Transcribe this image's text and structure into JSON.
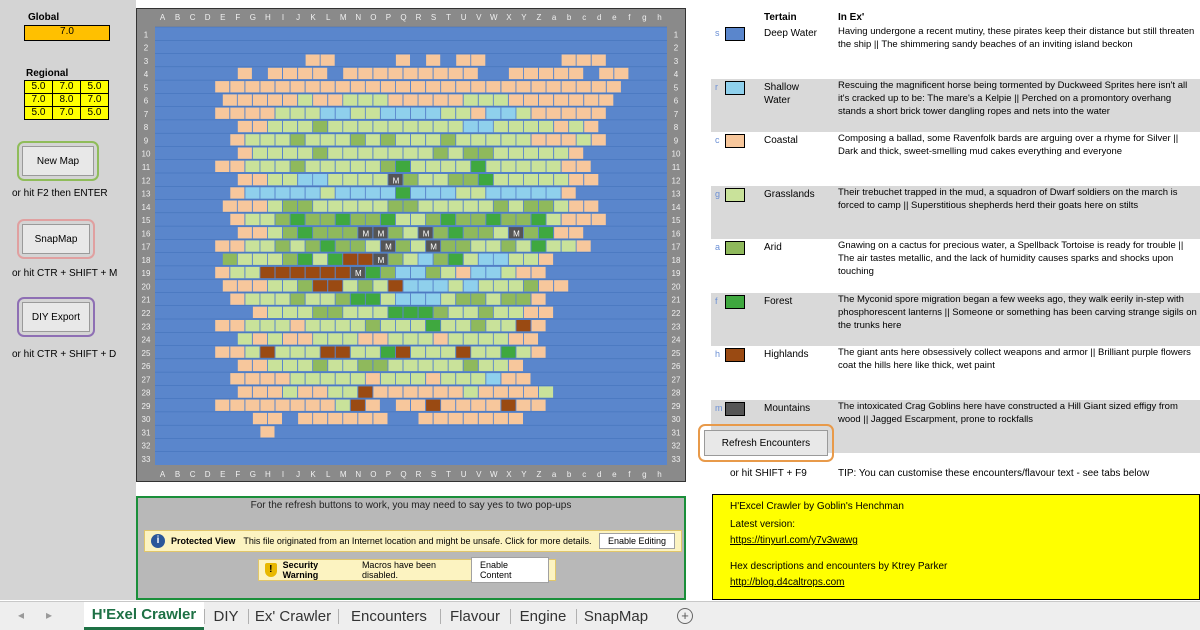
{
  "left": {
    "global_label": "Global",
    "global_value": "7.0",
    "regional_label": "Regional",
    "regional_values": [
      [
        "5.0",
        "7.0",
        "5.0"
      ],
      [
        "7.0",
        "8.0",
        "7.0"
      ],
      [
        "5.0",
        "7.0",
        "5.0"
      ]
    ],
    "new_map_label": "New Map",
    "new_map_hint": "or hit F2 then ENTER",
    "snapmap_label": "SnapMap",
    "snapmap_hint": "or hit CTR + SHIFT + M",
    "diy_label": "DIY Export",
    "diy_hint": "or hit CTR + SHIFT + D",
    "new_map_ring": "#8fbc5a",
    "snapmap_ring": "#e0a0a0",
    "diy_ring": "#8e6fb4"
  },
  "map": {
    "col_labels": [
      "A",
      "B",
      "C",
      "D",
      "E",
      "F",
      "G",
      "H",
      "I",
      "J",
      "K",
      "L",
      "M",
      "N",
      "O",
      "P",
      "Q",
      "R",
      "S",
      "T",
      "U",
      "V",
      "W",
      "X",
      "Y",
      "Z",
      "a",
      "b",
      "c",
      "d",
      "e",
      "f",
      "g",
      "h"
    ],
    "row_labels": [
      "1",
      "2",
      "3",
      "4",
      "5",
      "6",
      "7",
      "8",
      "9",
      "10",
      "11",
      "12",
      "13",
      "14",
      "15",
      "16",
      "17",
      "18",
      "19",
      "20",
      "21",
      "22",
      "23",
      "24",
      "25",
      "26",
      "27",
      "28",
      "29",
      "30",
      "31",
      "32",
      "33"
    ],
    "mountain_glyph": "M",
    "colors": {
      "s": "#5a86cc",
      "r": "#8fd0ec",
      "c": "#f7c79c",
      "g": "#c9e29a",
      "a": "#8fb95c",
      "f": "#3fa83f",
      "h": "#9a4a12",
      "m": "#555555"
    },
    "rows": [
      "ssssssssssssssssssssssssssssssssss",
      "ssssssssssssssssssssssssssssssssss",
      "ssssssssssccsssscscsccssssscccssss",
      "ssssscsccccscccccccccsscccccsccssss",
      "sssscccccccccccccccccccccccccccsss",
      "sssscccccgccgggcccccgggcccccccssss",
      "ssssccccgggrrggrrrrggcrrgcccccssss",
      "sssssccgggagggggggggrrggggcgcsssss",
      "ssssscgggagggagagggagggggcccgcssss",
      "ssssscggggagggggggagaagggggcsssss",
      "ssssccgggagggggafggggfgggggccsssss",
      "sssssccggrrggggmaggaafgggggccsssss",
      "ssssscrrrrrgrrrrfrrrggrrrrrcsssss",
      "sssscccgaagggggaagggggagaagccssss",
      "ssssscggafaafaafggafaafaafgcccssss",
      "sssssccgafaaammagmafaagmafccsssss",
      "ssssccggagafaagmagmaaggagfggcssss",
      "ssssagggafgfhhmagrafgrrggcssssss",
      "sssscgghhhhhhmfarragcrrgccsssss",
      "sssscccggahhgaghrrrgrgggaccssss",
      "ssssscgggaggaffgrrrgaagaacsssss",
      "sssssscgggaagggfffaggaggccssss",
      "ssssccgggcggggagggfggagghcsssss",
      "sssssgcgccgggccgggcggggccssss",
      "ssssccghggghhggfhggghggfgcssss",
      "sssssccgggaggaagggggaggcssss",
      "sssssccccgggggcgggcgggrccssss",
      "ssssscccgccgghccccccgccccgsssss",
      "ssssccccccccghcscchcccchccssss",
      "ssssssccsccccccsscccccccssss",
      "ssssssscssssssssssssssssssss",
      "ssssssssssssssssssssssssssssssssss",
      "ssssssssssssssssssssssssssssssssss"
    ]
  },
  "notice": {
    "top_text": "For the refresh buttons to work, you may need to say yes to two pop-ups",
    "protected_title": "Protected View",
    "protected_text": "This file originated from an Internet location and might be unsafe. Click for more details.",
    "enable_editing": "Enable Editing",
    "security_title": "Security Warning",
    "security_text": "Macros have been disabled.",
    "enable_content": "Enable Content"
  },
  "legend": {
    "header_terrain": "Tertain",
    "header_ex": "In Ex'",
    "rows": [
      {
        "code": "s",
        "name": "Deep Water",
        "text": "Having undergone a recent mutiny, these pirates keep their distance but still threaten the ship || The shimmering sandy beaches of an inviting island beckon",
        "swatch": "#5a86cc"
      },
      {
        "code": "r",
        "name": "Shallow Water",
        "text": "Rescuing the magnificent horse being tormented by Duckweed Sprites here isn't all it's cracked up to be: The mare's a Kelpie || Perched on a promontory overhang stands a short brick tower dangling ropes and nets into the water",
        "swatch": "#8fd0ec"
      },
      {
        "code": "c",
        "name": "Coastal",
        "text": "Composing a ballad, some Ravenfolk bards are arguing over a rhyme for Silver || Dark and thick, sweet-smelling mud cakes everything and everyone",
        "swatch": "#f7c79c"
      },
      {
        "code": "g",
        "name": "Grasslands",
        "text": "Their trebuchet trapped in the mud, a squadron of Dwarf soldiers on the march is forced to camp || Superstitious shepherds herd their goats here on stilts",
        "swatch": "#c9e29a"
      },
      {
        "code": "a",
        "name": "Arid",
        "text": "Gnawing on a cactus for precious water, a Spellback Tortoise is ready for trouble || The air tastes metallic, and the lack of humidity causes sparks and shocks upon touching",
        "swatch": "#8fb95c"
      },
      {
        "code": "f",
        "name": "Forest",
        "text": "The Myconid spore migration began a few weeks ago, they walk eerily in-step with phosphorescent lanterns || Someone or something has been carving strange sigils on the trunks here",
        "swatch": "#3fa83f"
      },
      {
        "code": "h",
        "name": "Highlands",
        "text": "The giant ants here obsessively collect weapons and armor || Brilliant purple flowers coat the hills here like thick, wet paint",
        "swatch": "#9a4a12"
      },
      {
        "code": "m",
        "name": "Mountains",
        "text": "The intoxicated Crag Goblins here have constructed a Hill Giant sized effigy from wood || Jagged Escarpment, prone to rockfalls",
        "swatch": "#555555"
      }
    ],
    "refresh_label": "Refresh Encounters",
    "refresh_hint": "or hit SHIFT + F9",
    "tip": "TIP: You can customise these encounters/flavour text - see tabs below",
    "refresh_ring": "#e89a4a"
  },
  "info": {
    "title": "H'Excel Crawler by Goblin's Henchman",
    "latest_label": "Latest version:",
    "latest_link": "https://tinyurl.com/y7v3wawg",
    "credits": "Hex descriptions and encounters by Ktrey Parker",
    "credits_link": "http://blog.d4caltrops.com"
  },
  "tabs": {
    "prev_arrow": "◂",
    "next_arrow": "▸",
    "items": [
      "H'Exel Crawler",
      "DIY",
      "Ex' Crawler",
      "Encounters",
      "Flavour",
      "Engine",
      "SnapMap"
    ],
    "add_glyph": "+"
  }
}
